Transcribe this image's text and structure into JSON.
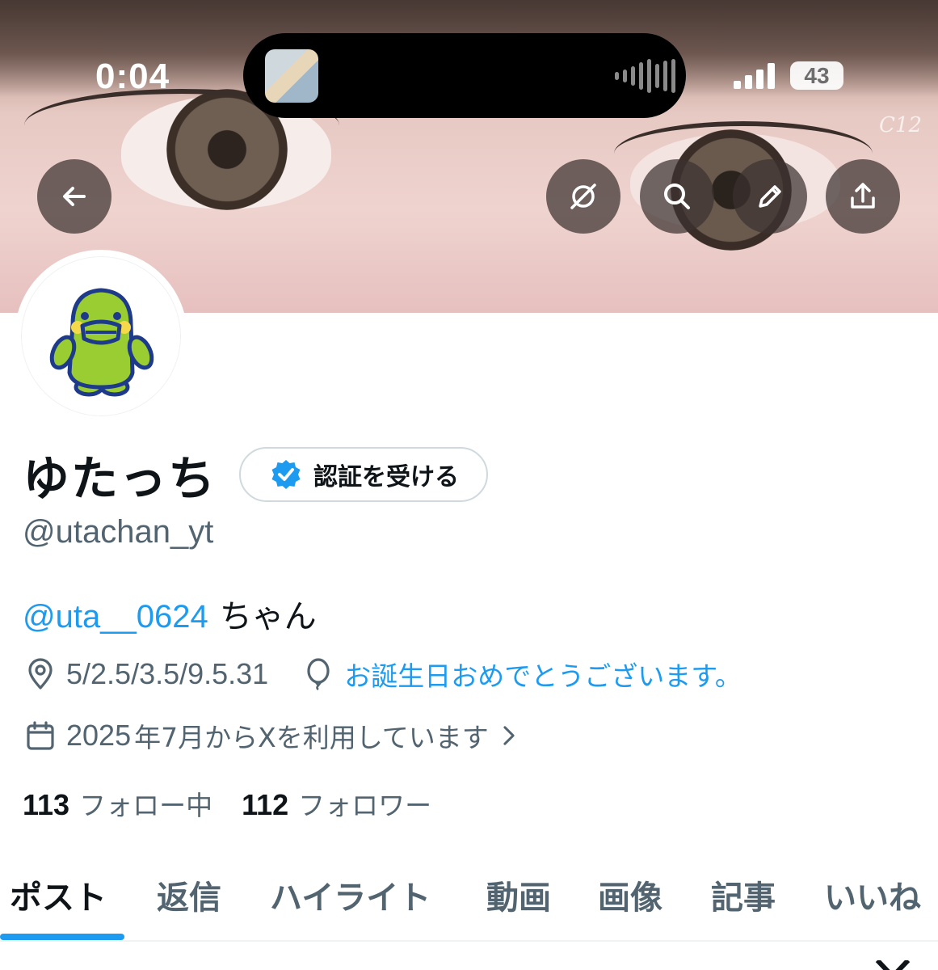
{
  "status_bar": {
    "time": "0:04",
    "battery": "43"
  },
  "banner": {
    "watermark": "C12"
  },
  "profile": {
    "display_name": "ゆたっち",
    "verify_label": "認証を受ける",
    "handle": "@utachan_yt",
    "bio_mention": "@uta__0624",
    "bio_rest": "ちゃん",
    "location": "5/2.5/3.5/9.5.31",
    "birthday_link": "お誕生日おめでとうございます。",
    "joined_number": "2025",
    "joined_text": "年7月からXを利用しています",
    "following_count": "113",
    "following_label": "フォロー中",
    "followers_count": "112",
    "followers_label": "フォロワー"
  },
  "tabs": [
    {
      "label": "ポスト",
      "active": true
    },
    {
      "label": "返信"
    },
    {
      "label": "ハイライト"
    },
    {
      "label": "動画"
    },
    {
      "label": "画像"
    },
    {
      "label": "記事"
    },
    {
      "label": "いいね"
    }
  ],
  "icons": [
    "back-arrow-icon",
    "grok-icon",
    "search-icon",
    "pencil-icon",
    "share-icon",
    "verified-badge-icon",
    "location-pin-icon",
    "balloon-icon",
    "calendar-icon",
    "chevron-right-icon",
    "audio-wave-icon",
    "signal-icon",
    "battery-icon"
  ],
  "colors": {
    "accent": "#1d9bf0",
    "text_primary": "#0f1419",
    "text_secondary": "#536471",
    "avatar_green": "#9acd32"
  }
}
